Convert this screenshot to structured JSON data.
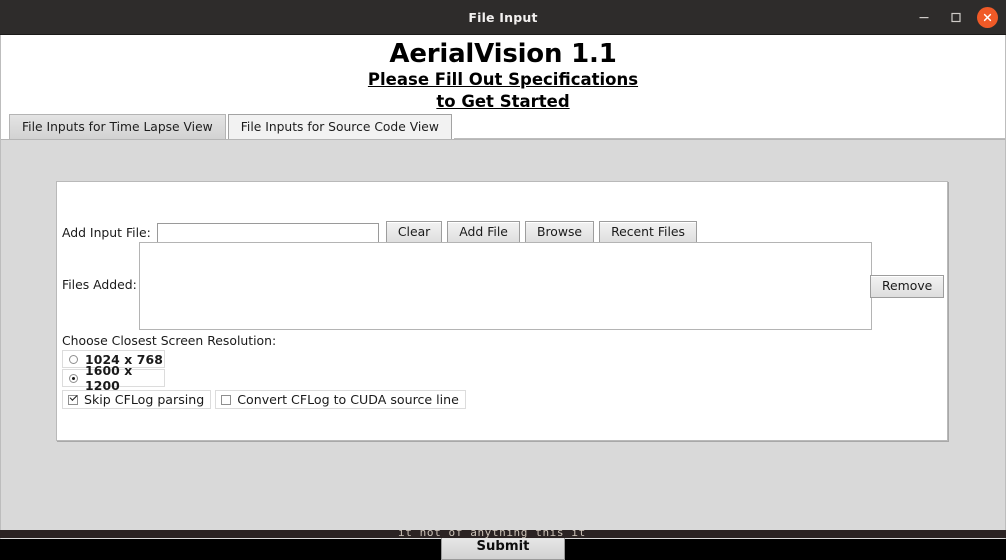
{
  "window": {
    "title": "File Input",
    "controls": {
      "minimize": "minimize-icon",
      "maximize": "maximize-icon",
      "close": "close-icon"
    },
    "close_color": "#f05a27",
    "titlebar_color": "#2e2c2b"
  },
  "header": {
    "app_title": "AerialVision 1.1",
    "subtitle_line1": "Please Fill Out Specifications ",
    "subtitle_line2": " to Get Started"
  },
  "tabs": [
    {
      "label": "File Inputs for Time Lapse View",
      "active": false
    },
    {
      "label": "File Inputs for Source Code View",
      "active": true
    }
  ],
  "form": {
    "add_input_label": "Add Input File:",
    "add_input_value": "",
    "add_input_placeholder": "",
    "buttons": [
      "Clear",
      "Add File",
      "Browse",
      "Recent Files"
    ],
    "files_added_label": "Files Added:",
    "files_added_items": [],
    "remove_label": "Remove",
    "resolution_label": "Choose Closest Screen Resolution:",
    "resolutions": [
      {
        "label": "1024 x 768",
        "selected": false
      },
      {
        "label": "1600 x 1200",
        "selected": true
      }
    ],
    "checkboxes": [
      {
        "label": "Skip CFLog parsing",
        "checked": true
      },
      {
        "label": "Convert CFLog to CUDA source line",
        "checked": false
      }
    ]
  },
  "footer": {
    "submit_label": "Submit"
  },
  "background": {
    "terminal_sliver_text": "it not of anything this it"
  }
}
